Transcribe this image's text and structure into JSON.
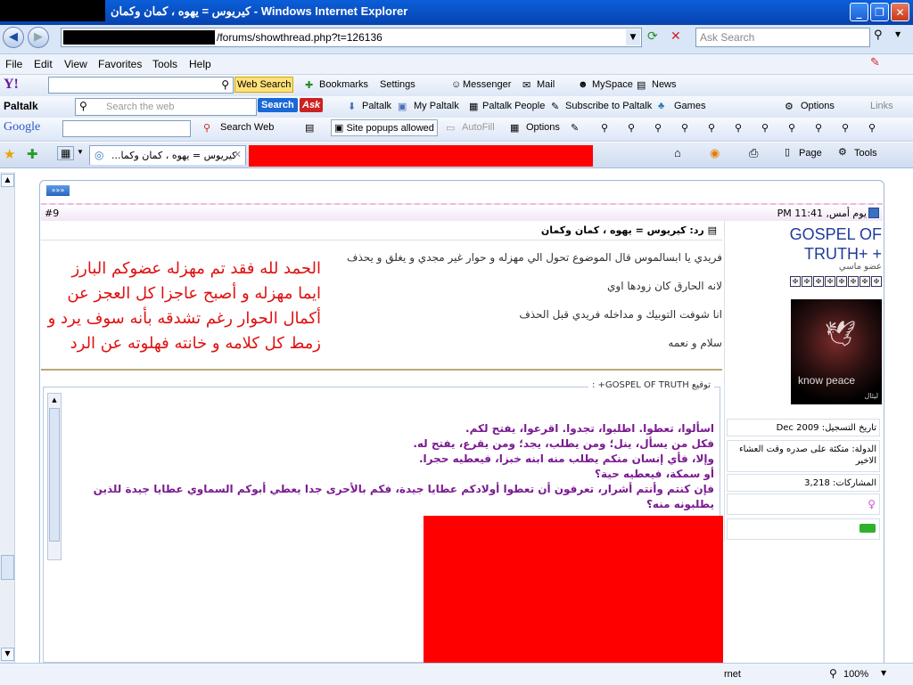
{
  "window": {
    "title": "كيريوس = يهوه ، كمان وكمان - Windows Internet Explorer",
    "controls": [
      "_",
      "❐",
      "✕"
    ]
  },
  "address": {
    "url": "/forums/showthread.php?t=126136",
    "search_placeholder": "Ask Search"
  },
  "menu": [
    "File",
    "Edit",
    "View",
    "Favorites",
    "Tools",
    "Help"
  ],
  "yahoo_toolbar": {
    "logo": "Y!",
    "web_search": "Web Search",
    "bookmarks": "Bookmarks",
    "settings": "Settings",
    "messenger": "Messenger",
    "mail": "Mail",
    "myspace": "MySpace",
    "news": "News"
  },
  "paltalk_toolbar": {
    "logo": "Paltalk",
    "search_placeholder": "Search the web",
    "search_button": "Search",
    "ask": "Ask",
    "paltalk": "Paltalk",
    "my_paltalk": "My Paltalk",
    "people": "Paltalk People",
    "subscribe": "Subscribe to Paltalk",
    "games": "Games",
    "options": "Options",
    "links": "Links"
  },
  "google_toolbar": {
    "logo": "Google",
    "search_web": "Search Web",
    "popups": "Site popups allowed",
    "autofill": "AutoFill",
    "options": "Options"
  },
  "tab": {
    "label": "كيريوس = يهوه ، كمان وكما...",
    "page_btn": "Page",
    "tools_btn": "Tools"
  },
  "post": {
    "date": "يوم أمس, 11:41 PM",
    "number": "#9",
    "title": "رد: كيريوس = يهوه ، كمان وكمان",
    "lines": [
      "فريدي يا ابسالموس قال الموضوع تحول الي مهزله و حوار غير مجدي و يغلق و يحذف",
      "لانه الحارق كان زودها اوي",
      "انا شوفت التوبيك و مداخله فريدي قبل الحذف",
      "سلام و نعمه"
    ],
    "quote_red": "الحمد لله فقد تم مهزله عضوكم البارز ايما مهزله و أصبح عاجزا كل العجز عن أكمال الحوار رغم تشدقه بأنه سوف يرد و زمط كل كلامه و خانته فهلوته عن الرد",
    "signature_label": "توقيع GOSPEL OF TRUTH+ :",
    "signature_lines": [
      "اسألوا، تعطوا. اطلبوا، تجدوا. اقرعوا، يفتح لكم.",
      "فكل من يسأل، ينل؛ ومن يطلب، يجد؛ ومن يقرع، يفتح له.",
      "وإلا، فأي إنسان منكم يطلب منه ابنه خبزا، فيعطيه حجرا.",
      "أو سمكة، فيعطيه حية؟",
      "فإن كنتم وأنتم أشرار، تعرفون أن تعطوا أولادكم عطايا جيدة، فكم بالأحرى جدا يعطي أبوكم السماوي عطايا جيدة للذين يطلبونه منه؟"
    ]
  },
  "user": {
    "name": "GOSPEL OF TRUTH+ +",
    "rank": "عضو ماسي",
    "avatar_text": "know peace",
    "avatar_caption": "ليئال",
    "joined_label": "تاريخ التسجيل:",
    "joined": "Dec 2009",
    "country_label": "الدولة:",
    "country": "متكئة على صدره وقت العشاء الاخير",
    "posts_label": "المشاركات:",
    "posts": "3,218"
  },
  "status": {
    "internet": "rnet",
    "zoom": "100%"
  }
}
